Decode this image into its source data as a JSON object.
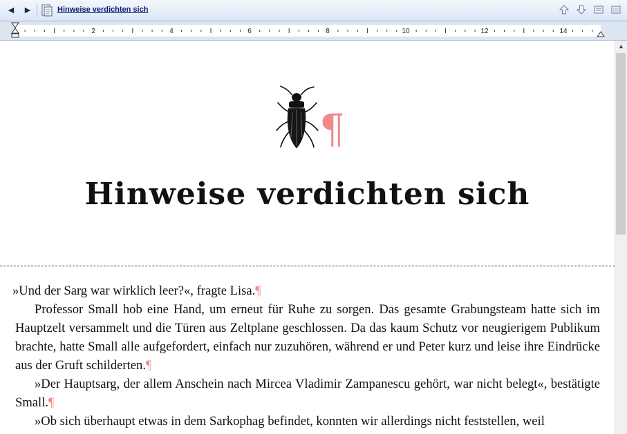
{
  "window": {
    "title": "Hinweise verdichten sich",
    "icons": [
      "back-arrow-icon",
      "forward-arrow-icon",
      "document-icon",
      "move-up-icon",
      "move-down-icon",
      "collapse-icon",
      "expand-icon"
    ]
  },
  "ruler": {
    "labels": [
      "2",
      "4",
      "6",
      "8",
      "10",
      "12",
      "14"
    ]
  },
  "document": {
    "chapter_title": "Hinweise verdichten sich",
    "paragraph_mark": "¶",
    "paragraphs": [
      "»Und der Sarg war wirklich leer?«, fragte Lisa.",
      "Professor Small hob eine Hand, um erneut für Ruhe zu sorgen. Das gesamte Grabungsteam hatte sich im Hauptzelt versammelt und die Türen aus Zeltplane geschlossen. Da das kaum Schutz vor neugierigem Publikum brachte, hatte Small alle aufgefordert, einfach nur zuzuhören, während er und Peter kurz und leise ihre Eindrücke aus der Gruft schilderten.",
      "»Der Hauptsarg, der allem Anschein nach Mircea Vladimir Zampanescu gehört, war nicht belegt«, bestätigte Small.",
      "»Ob sich überhaupt etwas in dem Sarkophag befindet, konnten wir allerdings nicht feststellen, weil"
    ]
  },
  "colors": {
    "formatting_marks": "#f08a8a",
    "title_link": "#0b1a6e"
  }
}
